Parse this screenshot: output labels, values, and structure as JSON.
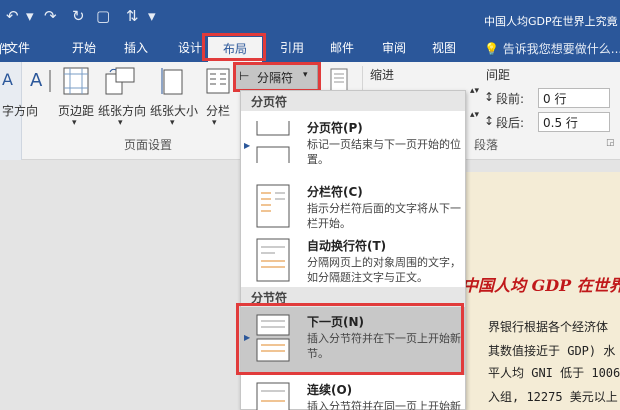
{
  "window": {
    "title": "中国人均GDP在世界上究竟",
    "qat_icons": [
      "undo-icon",
      "redo-icon",
      "format-painter-icon",
      "bold-icon",
      "text-direction-icon"
    ]
  },
  "tabs": [
    {
      "label": "文件",
      "active": false
    },
    {
      "label": "开始",
      "active": false
    },
    {
      "label": "插入",
      "active": false
    },
    {
      "label": "设计",
      "active": false
    },
    {
      "label": "布局",
      "active": true
    },
    {
      "label": "引用",
      "active": false
    },
    {
      "label": "邮件",
      "active": false
    },
    {
      "label": "审阅",
      "active": false
    },
    {
      "label": "视图",
      "active": false
    }
  ],
  "tell_me": "告诉我您想要做什么...",
  "ribbon": {
    "left_cut_labels": [
      "件",
      "字方向",
      "A"
    ],
    "text_direction": "字方向",
    "margins": "页边距",
    "orientation": "纸张方向",
    "size": "纸张大小",
    "columns": "分栏",
    "breaks_button": "分隔符",
    "group_page_setup": "页面设置",
    "indent_label": "缩进",
    "spacing_label": "间距",
    "before_label": "段前:",
    "before_value": "0 行",
    "after_label": "段后:",
    "after_value": "0.5 行",
    "group_paragraph": "段落"
  },
  "dropdown": {
    "section_page": "分页符",
    "section_section": "分节符",
    "items": [
      {
        "title": "分页符(P)",
        "desc": "标记一页结束与下一页开始的位置。"
      },
      {
        "title": "分栏符(C)",
        "desc": "指示分栏符后面的文字将从下一栏开始。"
      },
      {
        "title": "自动换行符(T)",
        "desc": "分隔网页上的对象周围的文字，如分隔题注文字与正文。"
      },
      {
        "title": "下一页(N)",
        "desc": "插入分节符并在下一页上开始新节。"
      },
      {
        "title": "连续(O)",
        "desc": "插入分节符并在同一页上开始新节。"
      }
    ]
  },
  "document": {
    "headline": "中国人均 GDP 在世界",
    "lines": [
      "界银行根据各个经济体",
      "其数值接近于 GDP) 水",
      "平人均 GNI 低于 1006",
      "入组, 12275 美元以上"
    ]
  },
  "colors": {
    "title_bar": "#2b579a",
    "highlight_box": "#e13b3b",
    "headline": "#c0181a"
  }
}
